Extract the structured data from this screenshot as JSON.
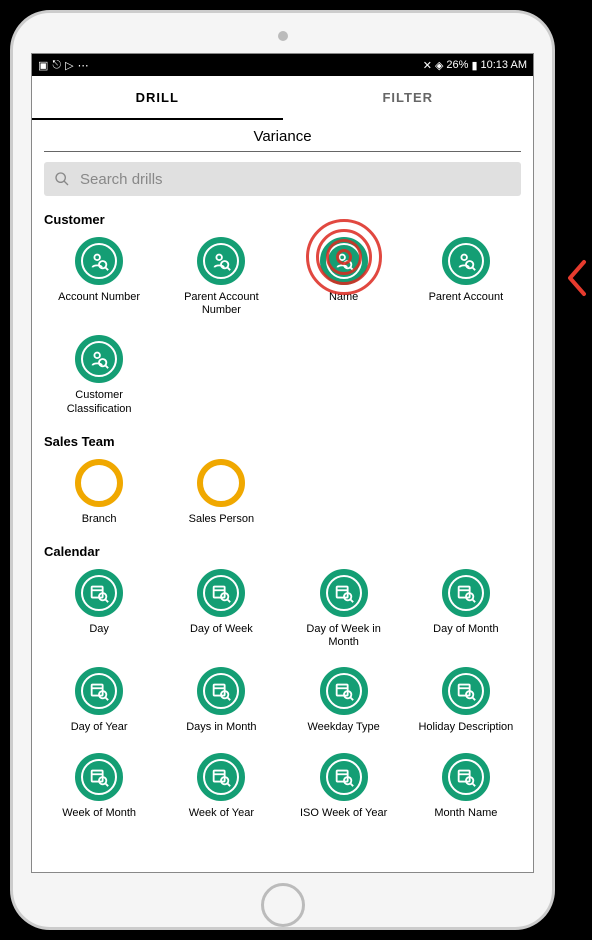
{
  "status_bar": {
    "battery_text": "26%",
    "time_text": "10:13 AM"
  },
  "tabs": {
    "drill": "DRILL",
    "filter": "FILTER"
  },
  "page_title": "Variance",
  "search": {
    "placeholder": "Search drills"
  },
  "sections": {
    "customer": {
      "title": "Customer",
      "items": [
        {
          "label": "Account Number"
        },
        {
          "label": "Parent Account Number"
        },
        {
          "label": "Name"
        },
        {
          "label": "Parent Account"
        },
        {
          "label": "Customer Classification"
        }
      ]
    },
    "sales_team": {
      "title": "Sales Team",
      "items": [
        {
          "label": "Branch"
        },
        {
          "label": "Sales Person"
        }
      ]
    },
    "calendar": {
      "title": "Calendar",
      "items": [
        {
          "label": "Day"
        },
        {
          "label": "Day of Week"
        },
        {
          "label": "Day of Week in Month"
        },
        {
          "label": "Day of Month"
        },
        {
          "label": "Day of Year"
        },
        {
          "label": "Days in Month"
        },
        {
          "label": "Weekday Type"
        },
        {
          "label": "Holiday Description"
        },
        {
          "label": "Week of Month"
        },
        {
          "label": "Week of Year"
        },
        {
          "label": "ISO Week of Year"
        },
        {
          "label": "Month Name"
        }
      ]
    }
  },
  "highlighted_item_index": 2
}
